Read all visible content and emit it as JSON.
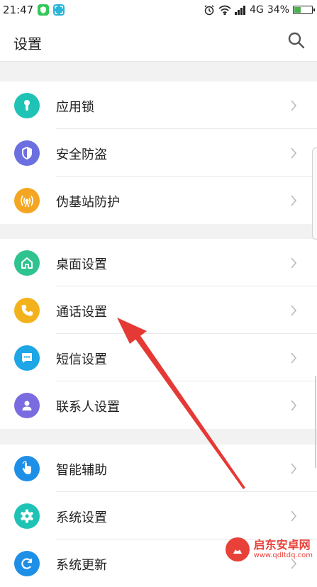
{
  "status_bar": {
    "time": "21:47",
    "network": "4G",
    "battery_percent": "34%",
    "battery_level": 0.34
  },
  "header": {
    "title": "设置"
  },
  "groups": [
    {
      "items": [
        {
          "label": "应用锁",
          "icon": "keyhole-icon",
          "color": "#1ec3b5"
        },
        {
          "label": "安全防盗",
          "icon": "shield-icon",
          "color": "#6c6fe0"
        },
        {
          "label": "伪基站防护",
          "icon": "signal-tower-icon",
          "color": "#f4a623"
        }
      ]
    },
    {
      "items": [
        {
          "label": "桌面设置",
          "icon": "home-icon",
          "color": "#2fc48f"
        },
        {
          "label": "通话设置",
          "icon": "phone-icon",
          "color": "#f3b21c"
        },
        {
          "label": "短信设置",
          "icon": "message-icon",
          "color": "#1ea6e6"
        },
        {
          "label": "联系人设置",
          "icon": "contact-icon",
          "color": "#7b6be0"
        }
      ]
    },
    {
      "items": [
        {
          "label": "智能辅助",
          "icon": "hand-pointer-icon",
          "color": "#1e8fe6"
        },
        {
          "label": "系统设置",
          "icon": "gear-icon",
          "color": "#1ec3b5"
        },
        {
          "label": "系统更新",
          "icon": "refresh-icon",
          "color": "#1e8fe6"
        }
      ]
    }
  ],
  "watermark": {
    "name": "启东安卓网",
    "url": "www.qdltdq.com"
  },
  "colors": {
    "annotation_arrow": "#e53935",
    "background": "#f2f2f2"
  }
}
